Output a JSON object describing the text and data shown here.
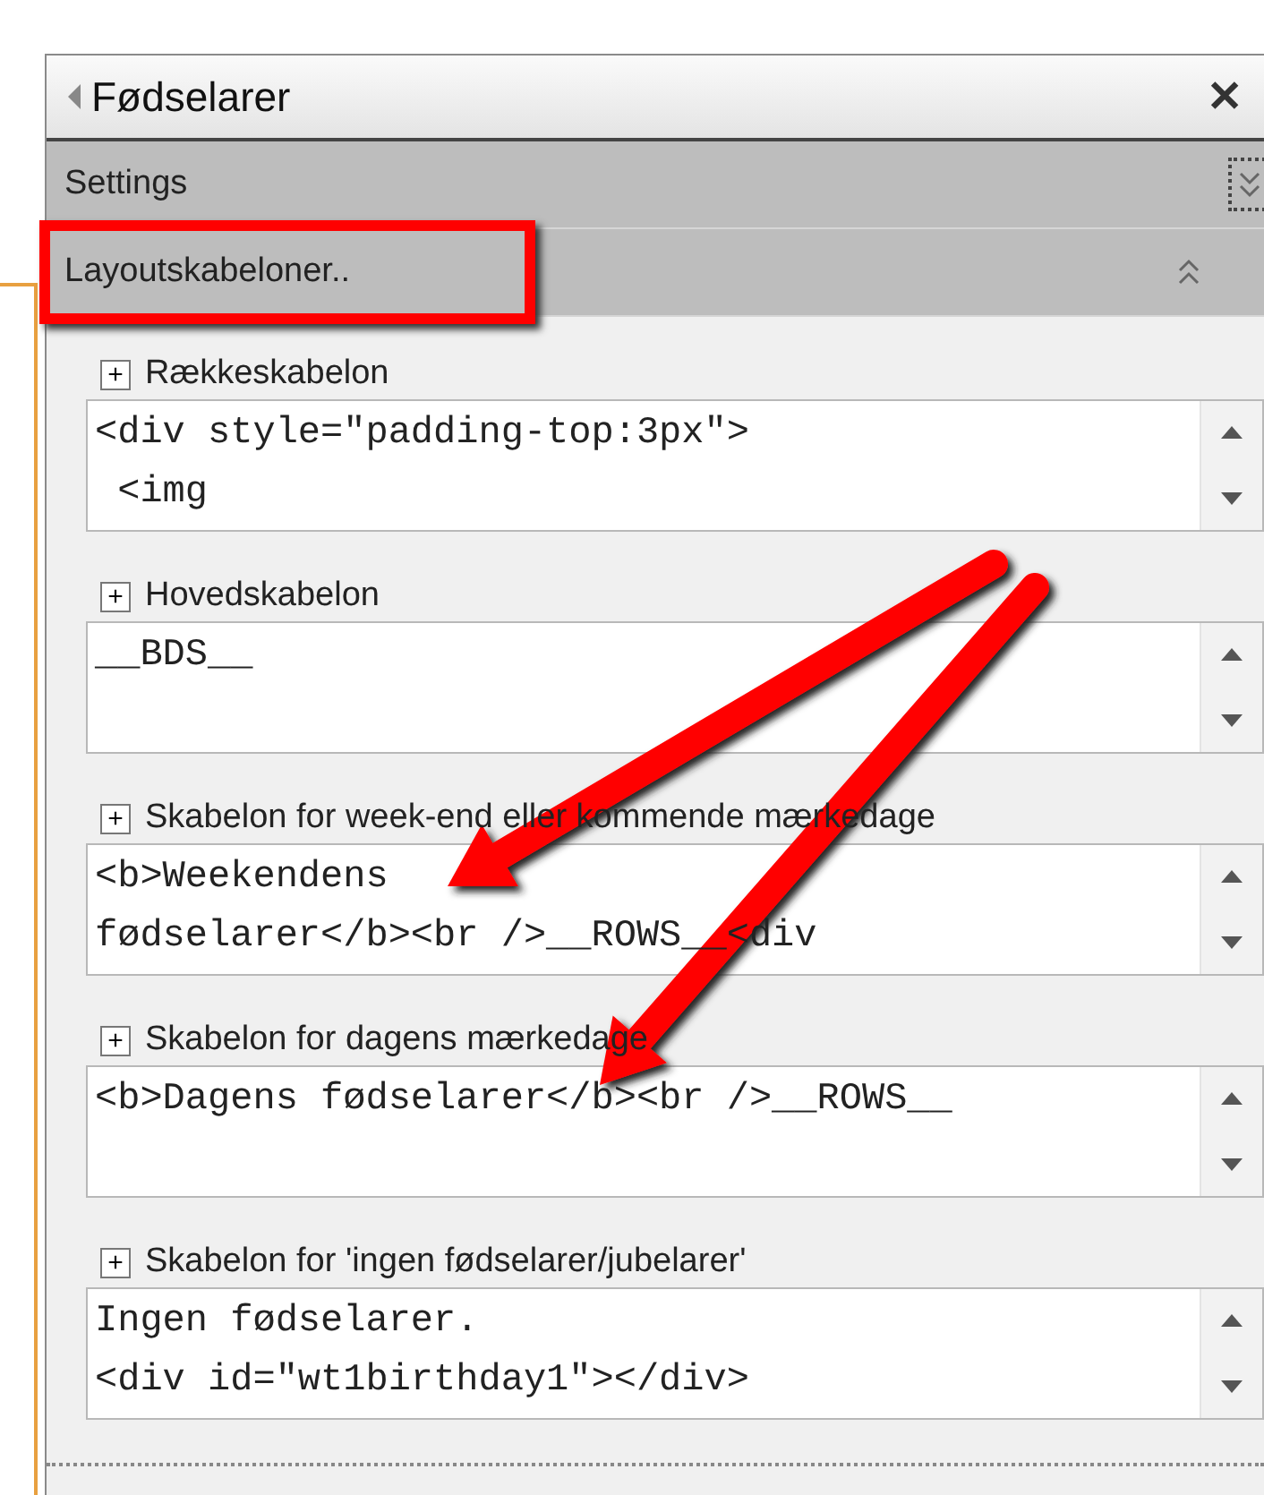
{
  "panel": {
    "title": "Fødselarer",
    "close": "✕"
  },
  "sections": [
    {
      "label": "Settings",
      "expanded": false,
      "focused": true,
      "highlighted": false
    },
    {
      "label": "Layoutskabeloner..",
      "expanded": true,
      "focused": false,
      "highlighted": true
    }
  ],
  "templates": [
    {
      "toggle": "+",
      "label": "Rækkeskabelon",
      "lines": [
        "<div style=\"padding-top:3px\">",
        " <img"
      ]
    },
    {
      "toggle": "+",
      "label": "Hovedskabelon",
      "lines": [
        "__BDS__"
      ]
    },
    {
      "toggle": "+",
      "label": "Skabelon for week-end eller kommende mærkedage",
      "lines": [
        "<b>Weekendens",
        "fødselarer</b><br />__ROWS__<div"
      ]
    },
    {
      "toggle": "+",
      "label": "Skabelon for dagens mærkedage",
      "lines": [
        "<b>Dagens fødselarer</b><br />__ROWS__"
      ]
    },
    {
      "toggle": "+",
      "label": "Skabelon for 'ingen fødselarer/jubelarer'",
      "lines": [
        "Ingen fødselarer.",
        "<div id=\"wt1birthday1\"></div>"
      ]
    }
  ]
}
